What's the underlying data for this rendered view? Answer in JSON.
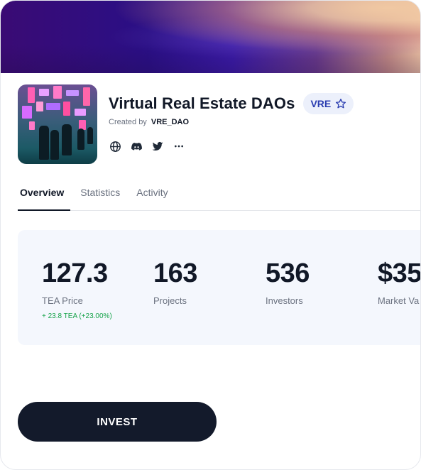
{
  "collection": {
    "title": "Virtual Real Estate DAOs",
    "ticker": "VRE",
    "created_by_label": "Created by",
    "creator": "VRE_DAO"
  },
  "socials": [
    {
      "icon": "globe-icon"
    },
    {
      "icon": "discord-icon"
    },
    {
      "icon": "twitter-icon"
    },
    {
      "icon": "more-icon"
    }
  ],
  "tabs": [
    {
      "label": "Overview",
      "active": true
    },
    {
      "label": "Statistics",
      "active": false
    },
    {
      "label": "Activity",
      "active": false
    }
  ],
  "stats": {
    "tea_price": {
      "value": "127.3",
      "label": "TEA Price",
      "change": "+ 23.8 TEA (+23.00%)"
    },
    "projects": {
      "value": "163",
      "label": "Projects"
    },
    "investors": {
      "value": "536",
      "label": "Investors"
    },
    "market_value": {
      "value": "$35",
      "label": "Market Va"
    }
  },
  "actions": {
    "invest_label": "INVEST"
  },
  "colors": {
    "accent_dark": "#131a2b",
    "badge_bg": "#ecf0fb",
    "badge_text": "#2a3db0",
    "positive": "#16a34a",
    "stats_bg": "#f4f7fd"
  }
}
